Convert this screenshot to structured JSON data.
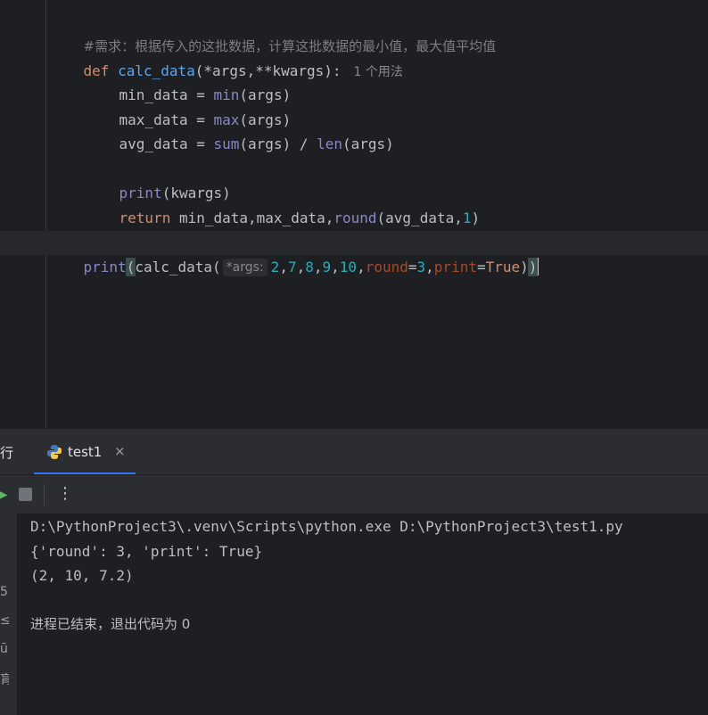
{
  "editor": {
    "comment": "#需求：根据传入的这批数据，计算这批数据的最小值，最大值平均值",
    "def_kw": "def",
    "func_name": "calc_data",
    "func_params": "(*args,**kwargs):",
    "usage_hint": "1 个用法",
    "l3_var": "min_data = ",
    "l3_fn": "min",
    "l3_arg": "(args)",
    "l4_var": "max_data = ",
    "l4_fn": "max",
    "l4_arg": "(args)",
    "l5_var": "avg_data = ",
    "l5_fn1": "sum",
    "l5_mid": "(args) / ",
    "l5_fn2": "len",
    "l5_arg": "(args)",
    "l7_fn": "print",
    "l7_arg": "(kwargs)",
    "l8_kw": "return",
    "l8_mid": " min_data,max_data,",
    "l8_fn": "round",
    "l8_open": "(avg_data,",
    "l8_num": "1",
    "l8_close": ")",
    "call_print": "print",
    "call_open": "(",
    "call_func": "calc_data(",
    "param_hint": "*args:",
    "nums": [
      "2",
      "7",
      "8",
      "9",
      "10"
    ],
    "kw1": "round",
    "kw1_val": "3",
    "kw2": "print",
    "kw2_val": "True",
    "call_close1": ")",
    "call_close2": ")"
  },
  "run_panel": {
    "title": "行",
    "tab_label": "test1",
    "close_glyph": "×",
    "more_glyph": "⋮",
    "rerun_glyph": "▶",
    "strip_glyphs": [
      "5",
      "≤",
      "ū",
      "肓"
    ]
  },
  "console": {
    "lines": [
      "D:\\PythonProject3\\.venv\\Scripts\\python.exe D:\\PythonProject3\\test1.py",
      "{'round': 3, 'print': True}",
      "(2, 10, 7.2)",
      "",
      "进程已结束，退出代码为 0"
    ]
  },
  "colors": {
    "background": "#1e1f22",
    "panel": "#2b2d30",
    "keyword": "#cf8e6d",
    "function": "#56a8f5",
    "builtin": "#8888c6",
    "number": "#2aacb8",
    "kwarg": "#aa4926",
    "accent": "#3574f0"
  }
}
